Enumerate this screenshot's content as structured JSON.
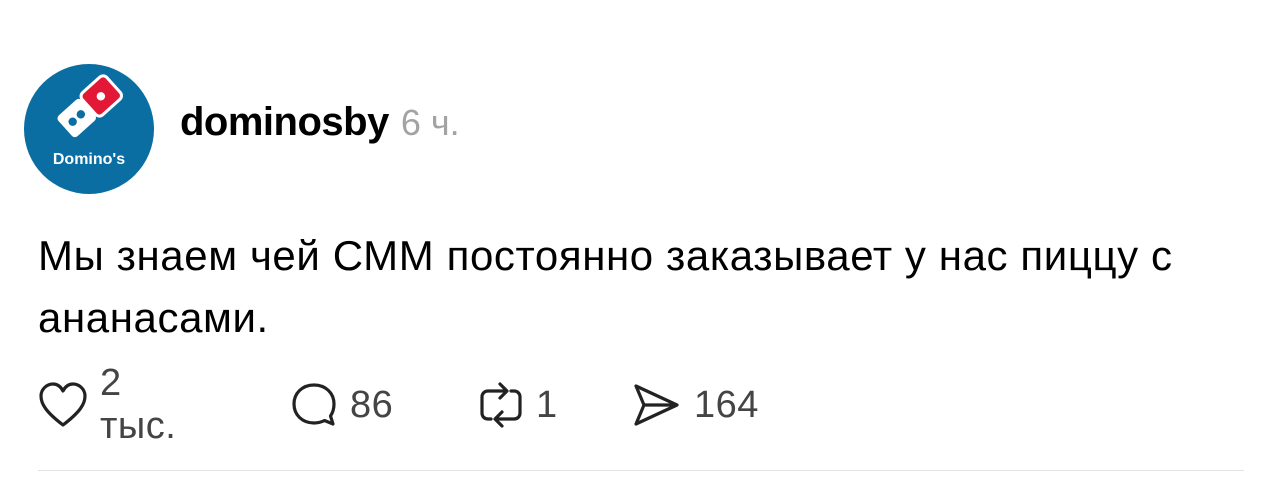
{
  "post": {
    "author": {
      "username": "dominosby",
      "avatar_logo_text": "Domino's",
      "avatar_icon": "dominos-logo-icon",
      "brand_colors": {
        "blue": "#0b6ea3",
        "red": "#e31837",
        "white": "#ffffff"
      }
    },
    "time": "6 ч.",
    "text": "Мы знаем чей СММ постоянно заказывает у нас пиццу с ананасами.",
    "actions": {
      "like": {
        "icon": "heart-icon",
        "count": "2 тыс."
      },
      "comment": {
        "icon": "speech-bubble-icon",
        "count": "86"
      },
      "repost": {
        "icon": "repost-arrows-icon",
        "count": "1"
      },
      "share": {
        "icon": "paper-plane-icon",
        "count": "164"
      }
    }
  },
  "colors": {
    "text": "#000000",
    "muted": "#a3a3a3",
    "count": "#444444",
    "divider": "#e2e2e2"
  }
}
